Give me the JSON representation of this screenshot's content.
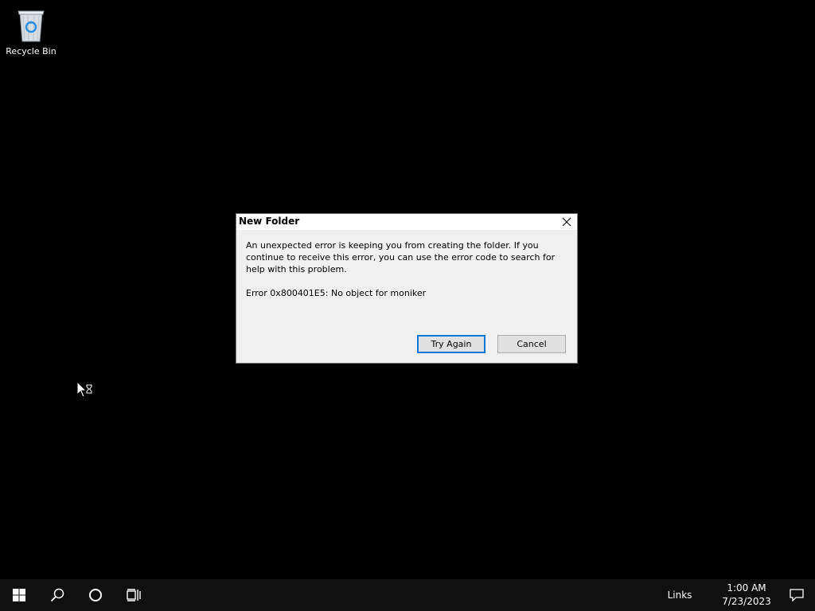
{
  "desktop": {
    "icons": [
      {
        "label": "Recycle Bin",
        "icon": "recycle-bin-icon"
      }
    ]
  },
  "dialog": {
    "title": "New Folder",
    "message": "An unexpected error is keeping you from creating the folder. If you continue to receive this error, you can use the error code to search for help with this problem.",
    "error_code": "Error 0x800401E5: No object for moniker",
    "buttons": {
      "try_again": "Try Again",
      "cancel": "Cancel"
    },
    "close_icon": "close-icon",
    "default_button": "try_again"
  },
  "cursor": {
    "icon": "arrow-busy-cursor-icon"
  },
  "taskbar": {
    "start_icon": "windows-start-icon",
    "search_icon": "search-icon",
    "cortana_icon": "cortana-circle-icon",
    "taskview_icon": "task-view-icon",
    "links_label": "Links",
    "time": "1:00 AM",
    "date": "7/23/2023",
    "notification_icon": "notification-icon"
  },
  "colors": {
    "desktop_background": "#000000",
    "taskbar_background": "#101010",
    "dialog_background": "#f0f0f0",
    "accent": "#0078d7"
  }
}
